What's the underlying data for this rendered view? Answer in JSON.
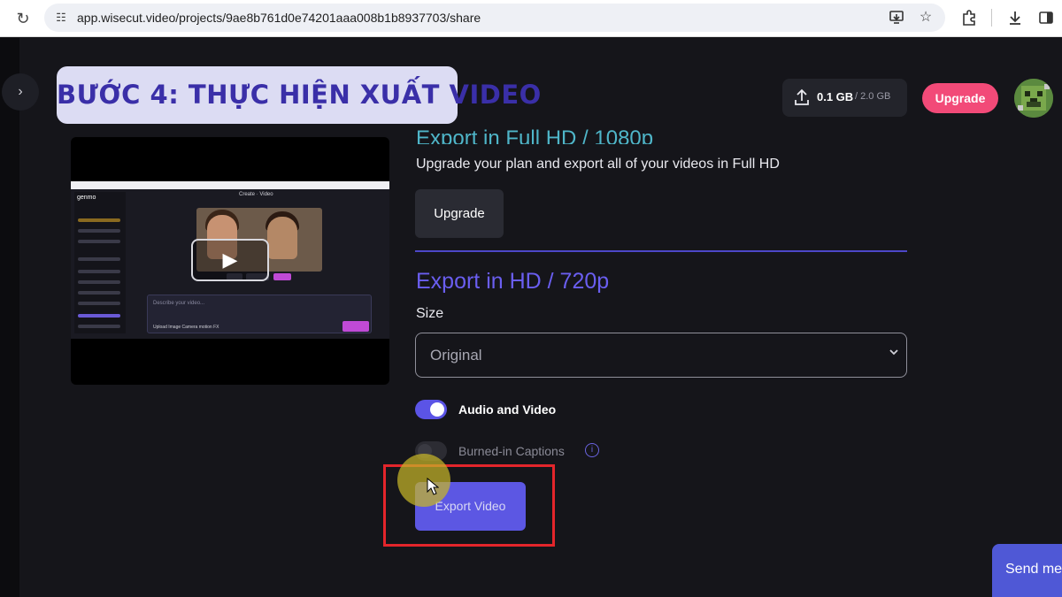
{
  "browser": {
    "url": "app.wisecut.video/projects/9ae8b761d0e74201aaa008b1b8937703/share",
    "icons": [
      "reload-icon",
      "site-info-icon",
      "install-app-icon",
      "bookmark-star-icon",
      "extensions-icon",
      "download-icon",
      "sidebar-icon"
    ]
  },
  "overlay": {
    "title": "BƯỚC 4: THỰC HIỆN XUẤT VIDEO"
  },
  "header": {
    "storage_used": "0.1 GB",
    "storage_total": "/ 2.0 GB",
    "upgrade_label": "Upgrade"
  },
  "export_full_hd": {
    "heading": "Export in Full HD / 1080p",
    "description": "Upgrade your plan and export all of your videos in Full HD",
    "upgrade_button": "Upgrade"
  },
  "export_hd": {
    "heading": "Export in HD / 720p",
    "size_label": "Size",
    "size_value": "Original",
    "options": [
      {
        "label": "Audio and Video",
        "enabled": true
      },
      {
        "label": "Burned-in Captions",
        "enabled": false
      }
    ],
    "export_button": "Export Video"
  },
  "preview": {
    "app_name": "genmo",
    "nav": "Create   ·   Video",
    "prompt_placeholder": "Describe your video...",
    "prompt_tools": "Upload Image     Camera motion     FX"
  },
  "chat": {
    "send_label": "Send message"
  },
  "colors": {
    "accent": "#5c57e3",
    "upgrade_pink": "#f24a78",
    "highlight_red": "#e3252b",
    "overlay_bg": "#dcdcf3",
    "overlay_text": "#3a2fa8"
  }
}
